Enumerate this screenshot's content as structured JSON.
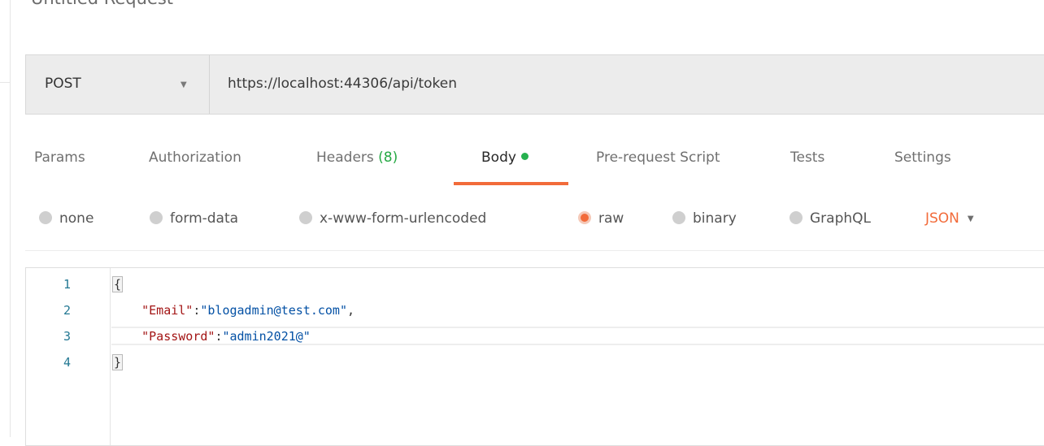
{
  "request": {
    "title": "Untitled Request",
    "method": "POST",
    "url": "https://localhost:44306/api/token"
  },
  "tabs": [
    {
      "label": "Params"
    },
    {
      "label": "Authorization"
    },
    {
      "label": "Headers",
      "count": "(8)"
    },
    {
      "label": "Body",
      "active": true
    },
    {
      "label": "Pre-request Script"
    },
    {
      "label": "Tests"
    },
    {
      "label": "Settings"
    }
  ],
  "body_types": [
    {
      "label": "none"
    },
    {
      "label": "form-data"
    },
    {
      "label": "x-www-form-urlencoded"
    },
    {
      "label": "raw",
      "selected": true
    },
    {
      "label": "binary"
    },
    {
      "label": "GraphQL"
    }
  ],
  "format": "JSON",
  "editor": {
    "lines": [
      {
        "num": "1",
        "text": "{"
      },
      {
        "num": "2",
        "key": "\"Email\"",
        "sep": ":",
        "value": "\"blogadmin@test.com\"",
        "end": ","
      },
      {
        "num": "3",
        "key": "\"Password\"",
        "sep": ":",
        "value": "\"admin2021@\"",
        "end": ""
      },
      {
        "num": "4",
        "text": "}"
      }
    ]
  },
  "colors": {
    "accent": "#f26b3a",
    "active_dot": "#26b14f",
    "count": "#26a944",
    "json_key": "#a31515",
    "json_string": "#0451a5",
    "line_number": "#237893"
  }
}
